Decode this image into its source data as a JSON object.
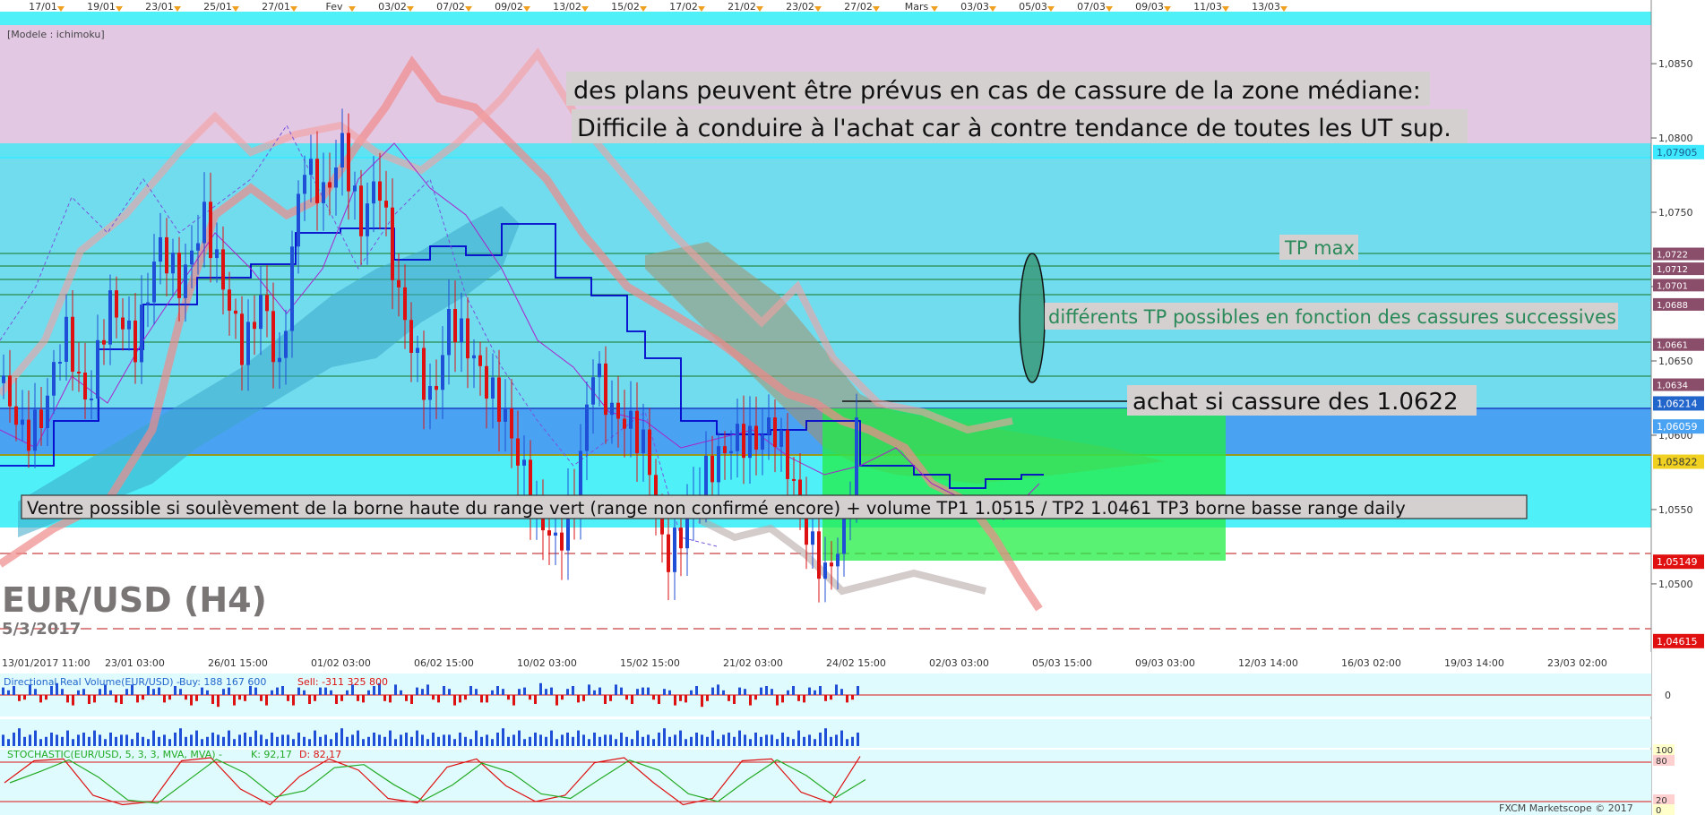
{
  "top_dates": [
    "17/01",
    "19/01",
    "23/01",
    "25/01",
    "27/01",
    "Fev",
    "03/02",
    "07/02",
    "09/02",
    "13/02",
    "15/02",
    "17/02",
    "21/02",
    "23/02",
    "27/02",
    "Mars",
    "03/03",
    "05/03",
    "07/03",
    "09/03",
    "11/03",
    "13/03"
  ],
  "model_label": "[Modele : ichimoku]",
  "symbol": "EUR/USD (H4)",
  "date": "5/3/2017",
  "annotations": {
    "line1": "des plans peuvent être prévus en cas de cassure de la zone médiane:",
    "line2": "Difficile à conduire à l'achat car à contre tendance de toutes les UT sup.",
    "tp_max": "TP max",
    "tp_list": "différents TP possibles en fonction des cassures successives",
    "buy": "achat si cassure des 1.0622",
    "sell": "Ventre possible si soulèvement de la borne haute du range vert (range non confirmé encore) + volume TP1 1.0515 / TP2 1.0461 TP3 borne basse range daily"
  },
  "right_axis_ticks": [
    "1,0850",
    "1,0800",
    "1,0750",
    "1,0700",
    "1,0650",
    "1,0600",
    "1,0550",
    "1,0500"
  ],
  "price_tags": [
    "1,07905",
    "1,06214",
    "1,06059",
    "1,05822",
    "1,05149",
    "1,04615"
  ],
  "tp_tags": [
    "1,0722",
    "1,0712",
    "1,0701",
    "1,0688",
    "1,0661",
    "1,0634"
  ],
  "bottom_axis": [
    "13/01/2017 11:00",
    "23/01 03:00",
    "26/01 15:00",
    "01/02 03:00",
    "06/02 15:00",
    "10/02 03:00",
    "15/02 15:00",
    "21/02 03:00",
    "24/02 15:00",
    "02/03 03:00",
    "05/03 15:00",
    "09/03 03:00",
    "12/03 14:00",
    "16/03 02:00",
    "19/03 14:00",
    "23/03 02:00"
  ],
  "volume_panel": {
    "title": "Directional Real Volume(EUR/USD) -",
    "buy": "Buy: 188 167 600",
    "sell": "Sell: -311 325 800",
    "zero": "0"
  },
  "stoch_panel": {
    "title": "STOCHASTIC(EUR/USD, 5, 3, 3, MVA, MVA) -",
    "k": "K: 92,17",
    "d": "D: 82,17",
    "levels": [
      "100",
      "80",
      "20",
      "0"
    ]
  },
  "copyright": "FXCM Marketscope © 2017",
  "colors": {
    "up": "#1f4fd6",
    "down": "#dd1111",
    "kijun": "#0000cc",
    "tenkan": "#aa22cc",
    "chikou": "#7755dd",
    "cloud": "#f08a8a",
    "range": "#22dd55",
    "sell_tag": "#e01010",
    "blue_tag": "#2266cc",
    "tp_tag": "#8a4d6a"
  },
  "chart_data": {
    "type": "candlestick",
    "instrument": "EUR/USD",
    "timeframe": "H4",
    "ylim": [
      1.0465,
      1.0885
    ],
    "levels": {
      "buy_breakout": 1.0622,
      "tp1": 1.0515,
      "tp2": 1.0461,
      "upper_band": 1.07905
    },
    "close_points": [
      [
        0,
        1.0635
      ],
      [
        25,
        1.0598
      ],
      [
        45,
        1.0612
      ],
      [
        70,
        1.0672
      ],
      [
        95,
        1.0618
      ],
      [
        120,
        1.069
      ],
      [
        150,
        1.066
      ],
      [
        175,
        1.073
      ],
      [
        200,
        1.07
      ],
      [
        225,
        1.0748
      ],
      [
        250,
        1.0695
      ],
      [
        270,
        1.0655
      ],
      [
        290,
        1.0695
      ],
      [
        310,
        1.064
      ],
      [
        335,
        1.0785
      ],
      [
        360,
        1.076
      ],
      [
        380,
        1.0795
      ],
      [
        400,
        1.074
      ],
      [
        420,
        1.0775
      ],
      [
        440,
        1.07
      ],
      [
        460,
        1.0655
      ],
      [
        480,
        1.062
      ],
      [
        500,
        1.068
      ],
      [
        520,
        1.066
      ],
      [
        540,
        1.0635
      ],
      [
        560,
        1.0615
      ],
      [
        580,
        1.0578
      ],
      [
        600,
        1.0545
      ],
      [
        620,
        1.0525
      ],
      [
        640,
        1.056
      ],
      [
        660,
        1.0648
      ],
      [
        680,
        1.0615
      ],
      [
        700,
        1.0608
      ],
      [
        720,
        1.059
      ],
      [
        740,
        1.0515
      ],
      [
        760,
        1.0535
      ],
      [
        780,
        1.057
      ],
      [
        800,
        1.0585
      ],
      [
        820,
        1.0598
      ],
      [
        840,
        1.0595
      ],
      [
        860,
        1.0608
      ],
      [
        880,
        1.0575
      ],
      [
        900,
        1.053
      ],
      [
        920,
        1.0505
      ],
      [
        940,
        1.0535
      ],
      [
        958,
        1.062
      ]
    ],
    "volume_bars": [
      4,
      2,
      5,
      3,
      2,
      6,
      3,
      4,
      2,
      5,
      7,
      3,
      4,
      6,
      2,
      3,
      5,
      4,
      3,
      6,
      2,
      4,
      5,
      3,
      6,
      4,
      2,
      5,
      3,
      4
    ],
    "stochastic_k_samples": [
      50,
      85,
      88,
      30,
      15,
      20,
      85,
      90,
      40,
      15,
      60,
      88,
      70,
      25,
      18,
      75,
      88,
      45,
      20,
      30,
      82,
      90,
      50,
      15,
      25,
      85,
      88,
      35,
      18,
      92
    ]
  }
}
